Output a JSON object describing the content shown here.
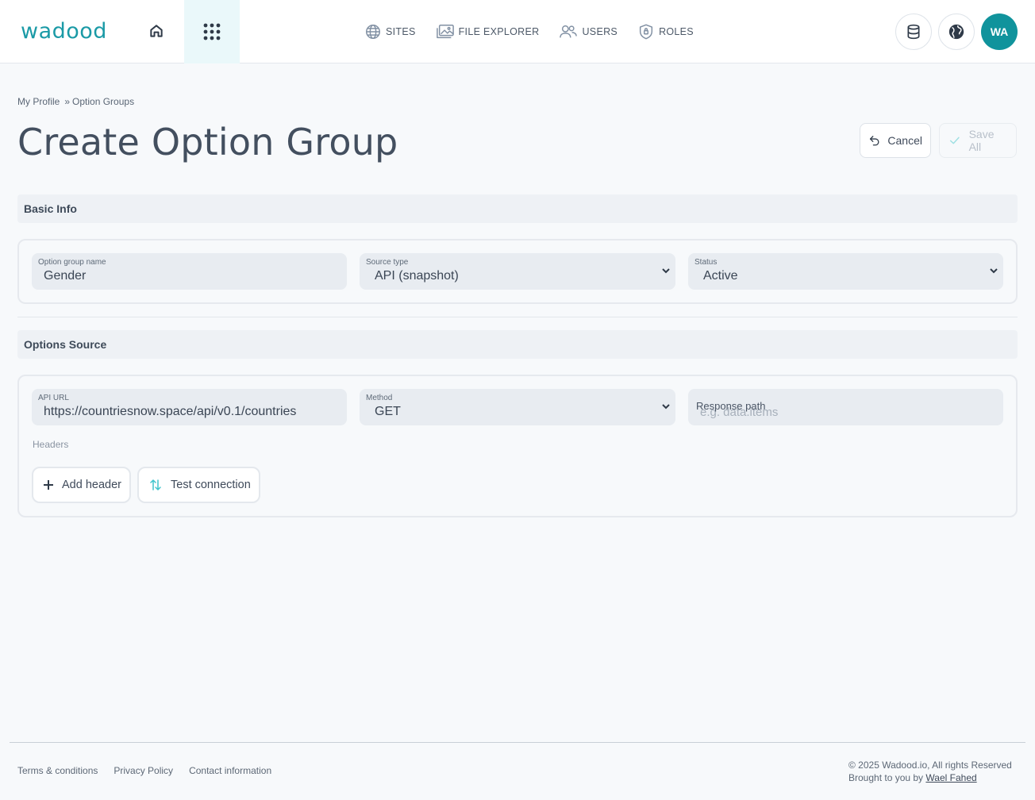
{
  "header": {
    "logo_text": "wadood",
    "nav": [
      {
        "label": "SITES",
        "icon": "globe-icon"
      },
      {
        "label": "FILE EXPLORER",
        "icon": "folder-image-icon"
      },
      {
        "label": "USERS",
        "icon": "users-icon"
      },
      {
        "label": "ROLES",
        "icon": "shield-icon"
      }
    ],
    "avatar_initials": "WA",
    "accent_color": "#10939c"
  },
  "breadcrumb": {
    "items": [
      "My Profile",
      "Option Groups"
    ],
    "separator": "»"
  },
  "page": {
    "title": "Create Option Group",
    "cancel_label": "Cancel",
    "save_label": "Save All"
  },
  "basic_info": {
    "section_title": "Basic Info",
    "name_field": {
      "label": "Option group name",
      "value": "Gender"
    },
    "source_type": {
      "label": "Source type",
      "value": "API (snapshot)"
    },
    "status": {
      "label": "Status",
      "value": "Active"
    }
  },
  "options_source": {
    "section_title": "Options Source",
    "api_url": {
      "label": "API URL",
      "value": "https://countriesnow.space/api/v0.1/countries"
    },
    "method": {
      "label": "Method",
      "value": "GET"
    },
    "response_path": {
      "label": "Response path",
      "placeholder": "e.g. data.items"
    },
    "headers_label": "Headers",
    "add_header_label": "Add header",
    "test_connection_label": "Test connection"
  },
  "footer": {
    "links": [
      "Terms & conditions",
      "Privacy Policy",
      "Contact information"
    ],
    "copyright": "© 2025 Wadood.io, All rights Reserved",
    "brought_by": "Brought to you by",
    "author": "Wael Fahed"
  }
}
